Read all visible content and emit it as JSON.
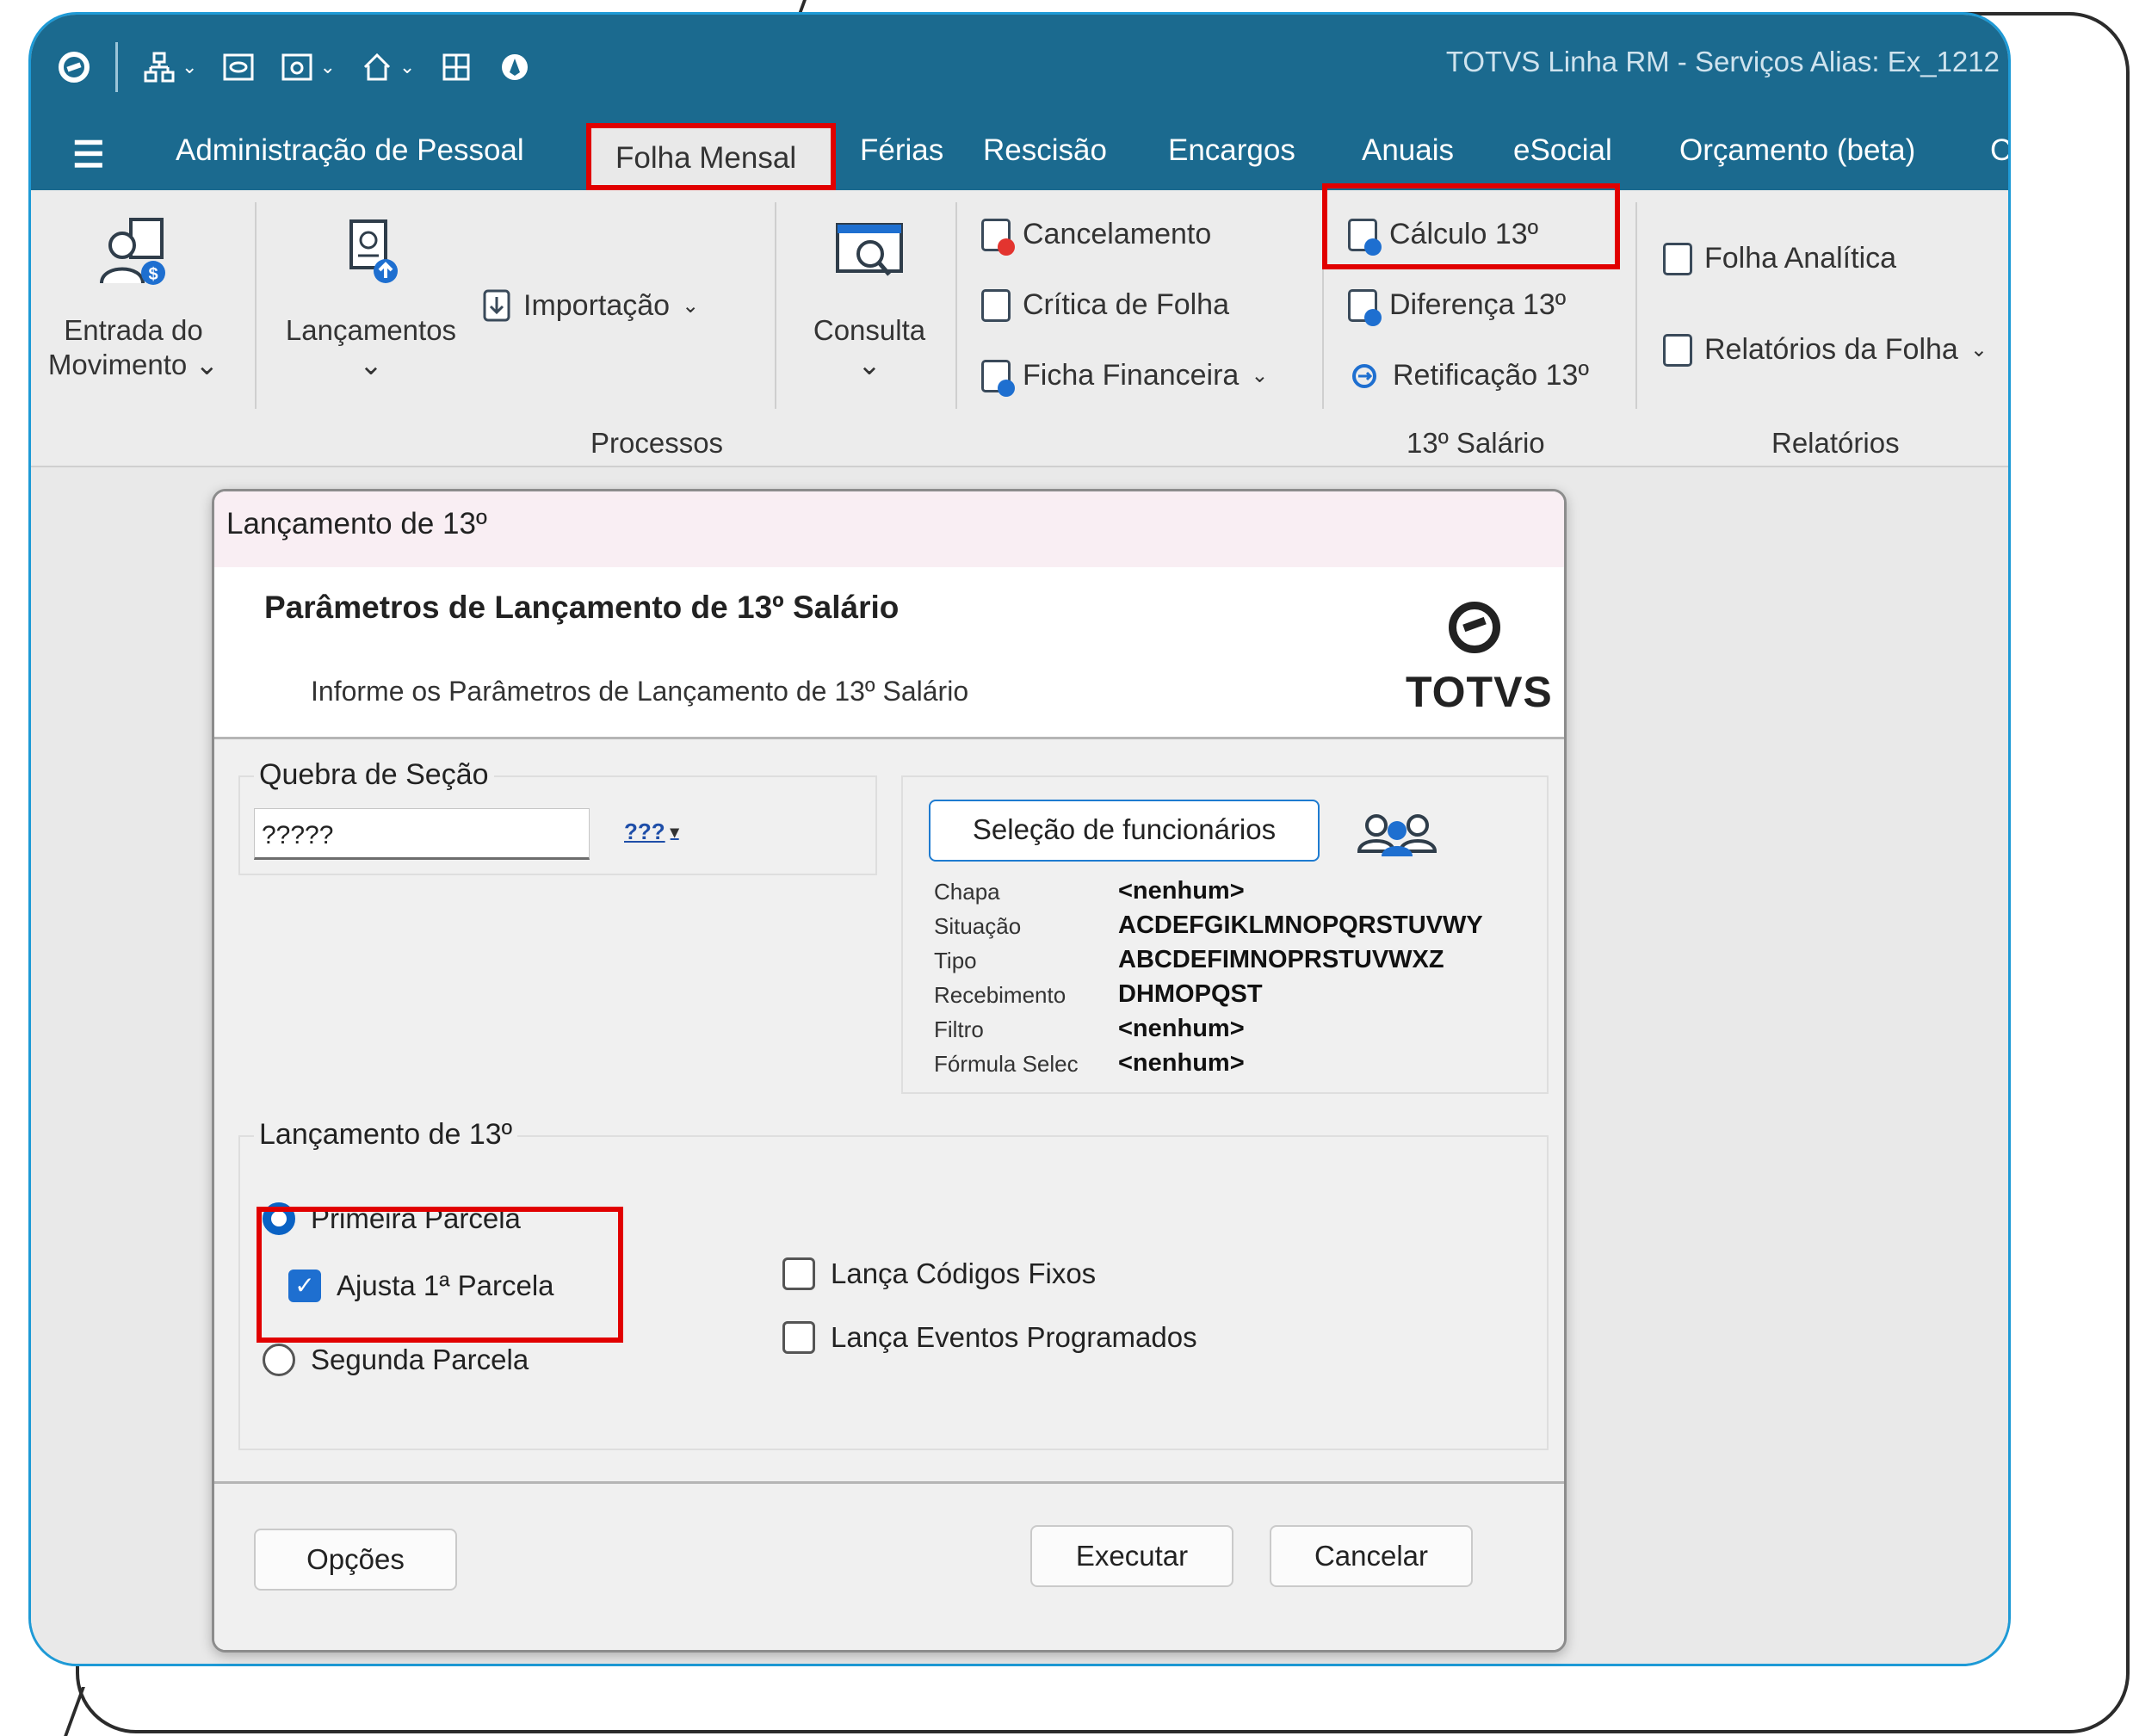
{
  "app": {
    "title": "TOTVS Linha RM - Serviços  Alias: Ex_1212"
  },
  "menu": {
    "items": [
      "Administração de Pessoal",
      "Folha Mensal",
      "Férias",
      "Rescisão",
      "Encargos",
      "Anuais",
      "eSocial",
      "Orçamento (beta)",
      "C"
    ],
    "active": "Folha Mensal"
  },
  "ribbon": {
    "entrada_label_1": "Entrada do",
    "entrada_label_2": "Movimento",
    "lancamentos_label": "Lançamentos",
    "importacao_label": "Importação",
    "consulta_label": "Consulta",
    "cancelamento_label": "Cancelamento",
    "critica_label": "Crítica de Folha",
    "ficha_label": "Ficha Financeira",
    "calculo_label": "Cálculo 13º",
    "diferenca_label": "Diferença 13º",
    "retificacao_label": "Retificação 13º",
    "folha_analitica_label": "Folha Analítica",
    "relatorios_folha_label": "Relatórios da Folha",
    "group_processos": "Processos",
    "group_13": "13º Salário",
    "group_relatorios": "Relatórios"
  },
  "dialog": {
    "title": "Lançamento de 13º",
    "heading": "Parâmetros de Lançamento de 13º Salário",
    "subheading": "Informe os Parâmetros de Lançamento de 13º Salário",
    "brand": "TOTVS",
    "quebra": {
      "legend": "Quebra de Seção",
      "value": "?????",
      "button_label": "???"
    },
    "selecao": {
      "button_label": "Seleção de funcionários",
      "rows": [
        {
          "label": "Chapa",
          "value": "<nenhum>"
        },
        {
          "label": "Situação",
          "value": "ACDEFGIKLMNOPQRSTUVWY"
        },
        {
          "label": "Tipo",
          "value": "ABCDEFIMNOPRSTUVWXZ"
        },
        {
          "label": "Recebimento",
          "value": "DHMOPQST"
        },
        {
          "label": "Filtro",
          "value": "<nenhum>"
        },
        {
          "label": "Fórmula Selec",
          "value": "<nenhum>"
        }
      ]
    },
    "lancamento": {
      "legend": "Lançamento de 13º",
      "primeira_parcela": "Primeira Parcela",
      "ajusta_parcela": "Ajusta 1ª Parcela",
      "segunda_parcela": "Segunda Parcela",
      "lanca_codigos": "Lança Códigos Fixos",
      "lanca_eventos": "Lança Eventos Programados"
    },
    "buttons": {
      "opcoes": "Opções",
      "executar": "Executar",
      "cancelar": "Cancelar"
    }
  },
  "colors": {
    "titlebar": "#1b6a8f",
    "highlight": "#e10000",
    "accent": "#0a62c4"
  }
}
